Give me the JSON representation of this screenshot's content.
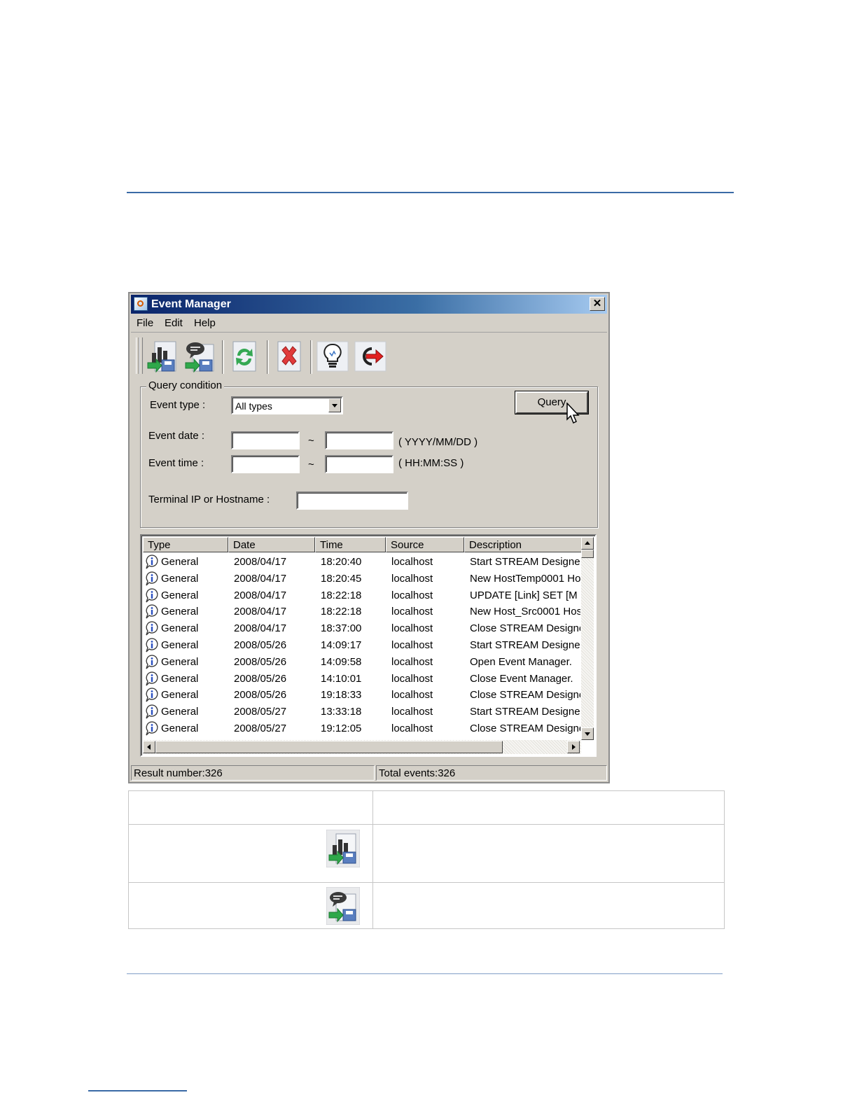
{
  "window": {
    "title": "Event Manager",
    "close_glyph": "✕"
  },
  "menu": [
    "File",
    "Edit",
    "Help"
  ],
  "toolbar": {
    "buttons": [
      {
        "name": "export-chart-icon"
      },
      {
        "name": "export-message-icon"
      },
      {
        "name": "refresh-icon"
      },
      {
        "name": "delete-icon"
      },
      {
        "name": "lightbulb-icon"
      },
      {
        "name": "exit-icon"
      }
    ]
  },
  "query": {
    "legend": "Query condition",
    "event_type_label": "Event type :",
    "event_type_value": "All types",
    "event_date_label": "Event date :",
    "event_time_label": "Event time :",
    "tilde": "~",
    "date_format": "( YYYY/MM/DD )",
    "time_format": "( HH:MM:SS )",
    "terminal_label": "Terminal IP or Hostname :",
    "query_button": "Query"
  },
  "list": {
    "columns": [
      "Type",
      "Date",
      "Time",
      "Source",
      "Description"
    ],
    "rows": [
      [
        "General",
        "2008/04/17",
        "18:20:40",
        "localhost",
        "Start STREAM Designe"
      ],
      [
        "General",
        "2008/04/17",
        "18:20:45",
        "localhost",
        "New HostTemp0001 Ho"
      ],
      [
        "General",
        "2008/04/17",
        "18:22:18",
        "localhost",
        "UPDATE [Link] SET [M"
      ],
      [
        "General",
        "2008/04/17",
        "18:22:18",
        "localhost",
        "New Host_Src0001 Hos"
      ],
      [
        "General",
        "2008/04/17",
        "18:37:00",
        "localhost",
        "Close STREAM Designe"
      ],
      [
        "General",
        "2008/05/26",
        "14:09:17",
        "localhost",
        "Start STREAM Designe"
      ],
      [
        "General",
        "2008/05/26",
        "14:09:58",
        "localhost",
        "Open Event Manager."
      ],
      [
        "General",
        "2008/05/26",
        "14:10:01",
        "localhost",
        "Close Event Manager."
      ],
      [
        "General",
        "2008/05/26",
        "19:18:33",
        "localhost",
        "Close STREAM Designe"
      ],
      [
        "General",
        "2008/05/27",
        "13:33:18",
        "localhost",
        "Start STREAM Designe"
      ],
      [
        "General",
        "2008/05/27",
        "19:12:05",
        "localhost",
        "Close STREAM Designe"
      ]
    ]
  },
  "status": {
    "result": "Result number:326",
    "total": "Total events:326"
  },
  "doc_table": {
    "rows": [
      {
        "icon": "export-chart-icon"
      },
      {
        "icon": "export-message-icon"
      }
    ]
  },
  "colors": {
    "title_gradient_start": "#0a246a",
    "title_gradient_end": "#a6caf0",
    "face": "#d4d0c8",
    "rule": "#3a6aa6"
  }
}
